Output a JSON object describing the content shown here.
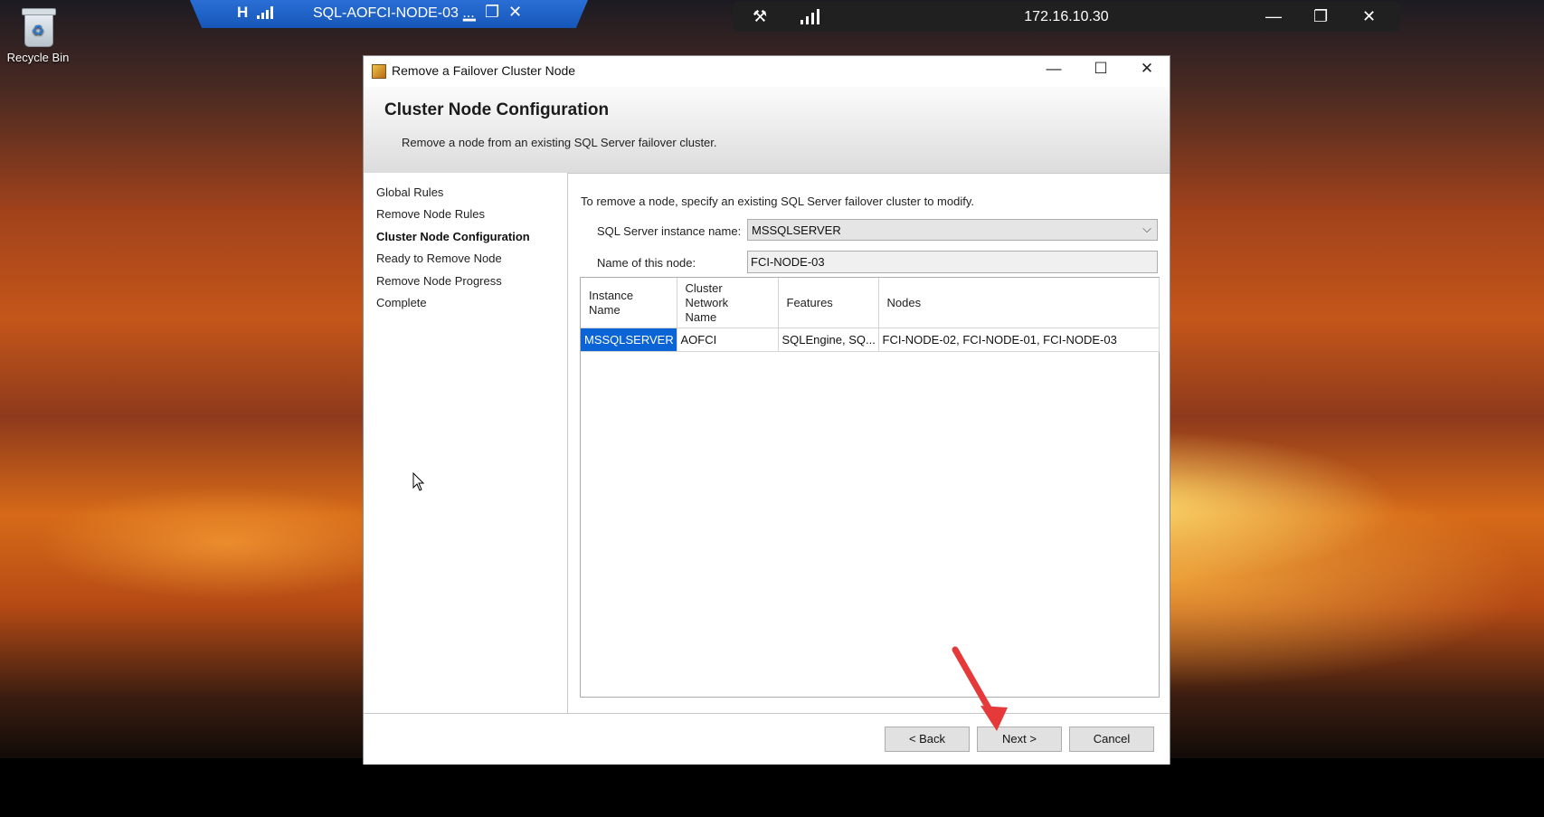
{
  "desktop": {
    "recycle_bin_label": "Recycle Bin"
  },
  "rdp_bar": {
    "title": "SQL-AOFCI-NODE-03 ...",
    "pin_glyph": "H",
    "minimize_glyph": "▁",
    "restore_glyph": "❐",
    "close_glyph": "✕"
  },
  "remote_bar": {
    "address": "172.16.10.30",
    "unpin_glyph": "⚒",
    "minimize_glyph": "—",
    "restore_glyph": "❐",
    "close_glyph": "✕"
  },
  "dialog": {
    "title": "Remove a Failover Cluster Node",
    "minimize_glyph": "—",
    "maximize_glyph": "☐",
    "close_glyph": "✕",
    "header": {
      "heading": "Cluster Node Configuration",
      "description": "Remove a node from an existing SQL Server failover cluster."
    },
    "steps": [
      {
        "label": "Global Rules",
        "current": false
      },
      {
        "label": "Remove Node Rules",
        "current": false
      },
      {
        "label": "Cluster Node Configuration",
        "current": true
      },
      {
        "label": "Ready to Remove Node",
        "current": false
      },
      {
        "label": "Remove Node Progress",
        "current": false
      },
      {
        "label": "Complete",
        "current": false
      }
    ],
    "intro": "To remove a node, specify an existing SQL Server failover cluster to modify.",
    "instance_label": "SQL Server instance name:",
    "instance_value": "MSSQLSERVER",
    "dropdown_glyph": "⌵",
    "node_label": "Name of this node:",
    "node_value": "FCI-NODE-03",
    "table": {
      "columns": [
        [
          "Instance",
          "Name"
        ],
        [
          "Cluster",
          "Network",
          "Name"
        ],
        [
          "Features"
        ],
        [
          "Nodes"
        ]
      ],
      "rows": [
        [
          "MSSQLSERVER",
          "AOFCI",
          "SQLEngine, SQ...",
          "FCI-NODE-02, FCI-NODE-01, FCI-NODE-03"
        ]
      ]
    },
    "buttons": {
      "back": "< Back",
      "next": "Next >",
      "cancel": "Cancel"
    }
  },
  "colors": {
    "selection": "#0a64d6",
    "annotation_arrow": "#e63a3a",
    "rdp_bar": "#1e63c9"
  }
}
